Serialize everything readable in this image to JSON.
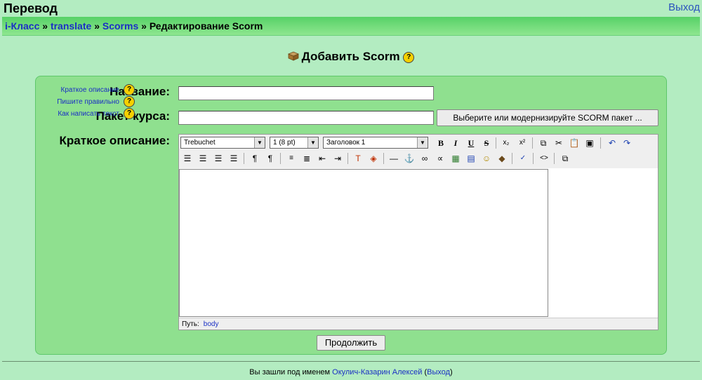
{
  "header": {
    "title": "Перевод",
    "logout_label": "Выход"
  },
  "breadcrumb": [
    {
      "label": "i-Класс"
    },
    {
      "label": "translate"
    },
    {
      "label": "Scorms"
    },
    {
      "label": "Редактирование Scorm"
    }
  ],
  "breadcrumb_separator": "»",
  "page": {
    "heading": "Добавить Scorm",
    "help_glyph": "?"
  },
  "form": {
    "name_label": "Название:",
    "name_value": "",
    "package_label": "Пакет курса:",
    "package_value": "",
    "package_button": "Выберите или модернизируйте SCORM пакет ...",
    "description_label": "Краткое описание:",
    "help_links": [
      "Краткое описание",
      "Пишите правильно",
      "Как написать текст"
    ],
    "continue_button": "Продолжить"
  },
  "editor": {
    "font_value": "Trebuchet",
    "size_value": "1 (8 pt)",
    "format_value": "Заголовок 1",
    "path_label": "Путь:",
    "path_value": "body"
  },
  "footer": {
    "prefix": "Вы зашли под именем",
    "user": "Окулич-Казарин Алексей",
    "logout": "Выход"
  },
  "colors": {
    "background": "#b3ecc1",
    "navbar": "#57d167",
    "panel": "#8fe08f",
    "link": "#1a2fc4"
  }
}
